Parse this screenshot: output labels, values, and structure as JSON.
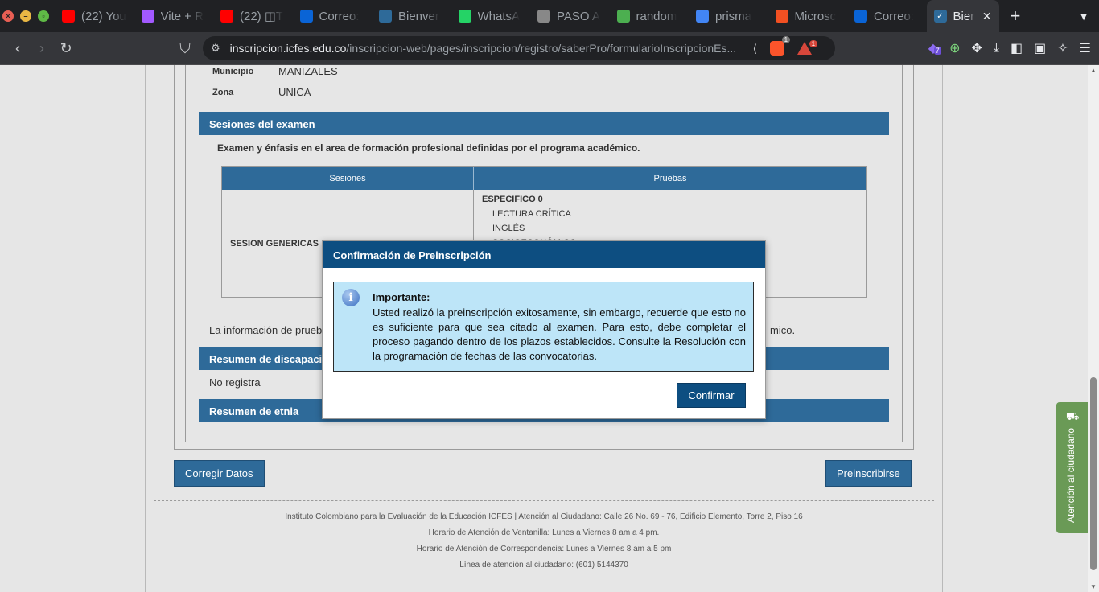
{
  "browser": {
    "tabs": [
      {
        "title": "(22) You",
        "icon": "youtube-icon",
        "color": "#ff0000"
      },
      {
        "title": "Vite + R",
        "icon": "vite-icon",
        "color": "#a259ff"
      },
      {
        "title": "(22) ◫T",
        "icon": "youtube-icon",
        "color": "#ff0000"
      },
      {
        "title": "Correo:",
        "icon": "outlook-icon",
        "color": "#0a64d6"
      },
      {
        "title": "Bienver",
        "icon": "icfes-icon",
        "color": "#2e6a99"
      },
      {
        "title": "WhatsA",
        "icon": "whatsapp-icon",
        "color": "#25d366"
      },
      {
        "title": "PASO A",
        "icon": "globe-icon",
        "color": "#888888"
      },
      {
        "title": "random",
        "icon": "random-icon",
        "color": "#4caf50"
      },
      {
        "title": "prisma",
        "icon": "google-icon",
        "color": "#4285f4"
      },
      {
        "title": "Microsc",
        "icon": "microsoft-icon",
        "color": "#f25022"
      },
      {
        "title": "Correo:",
        "icon": "outlook-icon",
        "color": "#0a64d6"
      }
    ],
    "active_tab": {
      "title": "Bier",
      "icon": "icfes-icon"
    },
    "url_host": "inscripcion.icfes.edu.co",
    "url_path": "/inscripcion-web/pages/inscripcion/registro/saberPro/formularioInscripcionEs...",
    "brave_badge": "1",
    "alert_badge": "1",
    "ext_badge": "7"
  },
  "location": {
    "municipio_label": "Municipio",
    "municipio_value": "MANIZALES",
    "zona_label": "Zona",
    "zona_value": "UNICA"
  },
  "sesiones": {
    "header": "Sesiones del examen",
    "subtitle": "Examen y énfasis en el area de formación profesional definidas por el programa académico.",
    "col_sesiones": "Sesiones",
    "col_pruebas": "Pruebas",
    "session_name": "SESION GENERICAS",
    "group": "ESPECIFICO 0",
    "pruebas": [
      "LECTURA CRÍTICA",
      "INGLÉS",
      "SOCIOECONÓMICO"
    ]
  },
  "info_text_left": "La información de prueb",
  "info_text_right": "mico.",
  "discapacidad": {
    "header": "Resumen de discapaci",
    "value": "No registra"
  },
  "etnia": {
    "header": "Resumen de etnia"
  },
  "buttons": {
    "corregir": "Corregir Datos",
    "preinscribirse": "Preinscribirse"
  },
  "footer": {
    "line1": "Instituto Colombiano para la Evaluación de la Educación ICFES  |   Atención al Ciudadano: Calle 26 No. 69 - 76, Edificio Elemento, Torre 2, Piso 16",
    "line2": "Horario de Atención de Ventanilla: Lunes a Viernes 8 am a 4 pm.",
    "line3": "Horario de Atención de Correspondencia: Lunes a Viernes 8 am a 5 pm",
    "line4": "Línea de atención al ciudadano: (601) 5144370"
  },
  "side_widget": "Atención al ciudadano",
  "dialog": {
    "title": "Confirmación de Preinscripción",
    "msg_title": "Importante:",
    "msg_body": "Usted realizó la preinscripción exitosamente, sin embargo, recuerde que esto no es suficiente para que sea citado al examen. Para esto, debe completar el proceso pagando dentro de los plazos establecidos. Consulte la Resolución con la programación de fechas de las convocatorias.",
    "confirm": "Confirmar"
  }
}
